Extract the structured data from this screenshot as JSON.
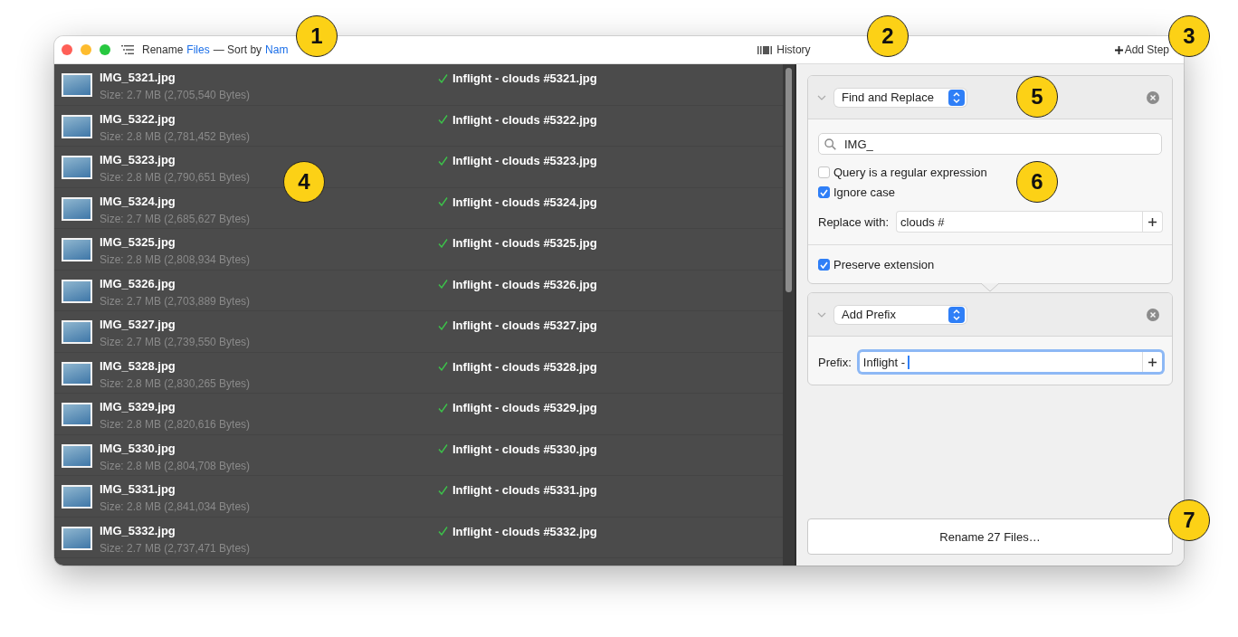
{
  "window": {
    "title": "Rename",
    "title_link": "Files",
    "sort_label": "— Sort by",
    "sort_link": "Nam",
    "history": "History",
    "add_step": "Add Step"
  },
  "files": [
    {
      "name": "IMG_5321.jpg",
      "size": "Size: 2.7 MB (2,705,540 Bytes)",
      "new_name": "Inflight - clouds #5321.jpg"
    },
    {
      "name": "IMG_5322.jpg",
      "size": "Size: 2.8 MB (2,781,452 Bytes)",
      "new_name": "Inflight - clouds #5322.jpg"
    },
    {
      "name": "IMG_5323.jpg",
      "size": "Size: 2.8 MB (2,790,651 Bytes)",
      "new_name": "Inflight - clouds #5323.jpg"
    },
    {
      "name": "IMG_5324.jpg",
      "size": "Size: 2.7 MB (2,685,627 Bytes)",
      "new_name": "Inflight - clouds #5324.jpg"
    },
    {
      "name": "IMG_5325.jpg",
      "size": "Size: 2.8 MB (2,808,934 Bytes)",
      "new_name": "Inflight - clouds #5325.jpg"
    },
    {
      "name": "IMG_5326.jpg",
      "size": "Size: 2.7 MB (2,703,889 Bytes)",
      "new_name": "Inflight - clouds #5326.jpg"
    },
    {
      "name": "IMG_5327.jpg",
      "size": "Size: 2.7 MB (2,739,550 Bytes)",
      "new_name": "Inflight - clouds #5327.jpg"
    },
    {
      "name": "IMG_5328.jpg",
      "size": "Size: 2.8 MB (2,830,265 Bytes)",
      "new_name": "Inflight - clouds #5328.jpg"
    },
    {
      "name": "IMG_5329.jpg",
      "size": "Size: 2.8 MB (2,820,616 Bytes)",
      "new_name": "Inflight - clouds #5329.jpg"
    },
    {
      "name": "IMG_5330.jpg",
      "size": "Size: 2.8 MB (2,804,708 Bytes)",
      "new_name": "Inflight - clouds #5330.jpg"
    },
    {
      "name": "IMG_5331.jpg",
      "size": "Size: 2.8 MB (2,841,034 Bytes)",
      "new_name": "Inflight - clouds #5331.jpg"
    },
    {
      "name": "IMG_5332.jpg",
      "size": "Size: 2.7 MB (2,737,471 Bytes)",
      "new_name": "Inflight - clouds #5332.jpg"
    }
  ],
  "steps": [
    {
      "kind": "find_replace",
      "title": "Find and Replace",
      "query": "IMG_",
      "options": [
        {
          "label": "Query is a regular expression",
          "checked": false
        },
        {
          "label": "Ignore case",
          "checked": true
        }
      ],
      "replace_label": "Replace with:",
      "replace_value": "clouds #",
      "preserve": {
        "label": "Preserve extension",
        "checked": true
      }
    },
    {
      "kind": "add_prefix",
      "title": "Add Prefix",
      "prefix_label": "Prefix:",
      "prefix_value": "Inflight -",
      "focused": true
    }
  ],
  "rename_button": "Rename 27 Files…",
  "callouts": [
    "1",
    "2",
    "3",
    "4",
    "5",
    "6",
    "7"
  ]
}
